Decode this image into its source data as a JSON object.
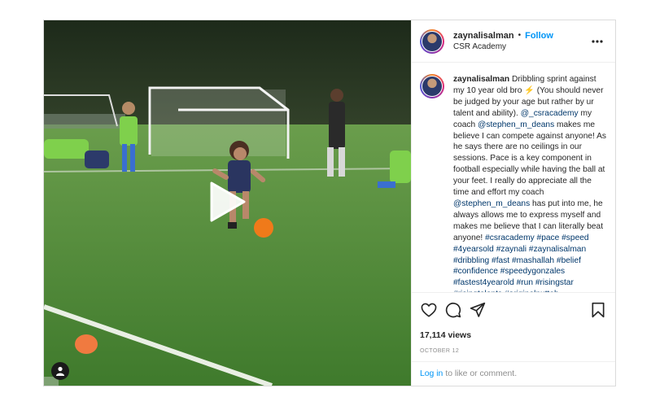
{
  "post": {
    "username": "zaynalisalman",
    "separator": "•",
    "follow_label": "Follow",
    "location": "CSR Academy"
  },
  "caption": {
    "username": "zaynalisalman",
    "t1": "Dribbling sprint against my 10 year old bro ",
    "emoji": "⚡️",
    "t2": " (You should never be judged by your age but rather by ur talent and ability). ",
    "mention1": "@_csracademy",
    "t3": " my coach ",
    "mention2": "@stephen_m_deans",
    "t4": " makes me believe I can compete against anyone! As he says there are no ceilings in our sessions. Pace is a key component in football especially while having the ball at your feet. I really do appreciate all the time and effort my coach ",
    "mention3": "@stephen_m_deans",
    "t5": " has put into me, he always allows me to express myself and makes me believe that I can literally beat anyone! ",
    "hashtags": [
      "#csracademy",
      "#pace",
      "#speed",
      "#4yearsold",
      "#zaynali",
      "#zaynalisalman",
      "#dribbling",
      "#fast",
      "#mashallah",
      "#belief",
      "#confidence",
      "#speedygonzales",
      "#fastest4yearold",
      "#run",
      "#risingstar",
      "#risingtalents",
      "#originalnuttah"
    ]
  },
  "stats": {
    "views": "17,114 views",
    "date": "October 12"
  },
  "login": {
    "link": "Log in",
    "text": "to like or comment."
  },
  "icons": {
    "like": "heart-icon",
    "comment": "comment-icon",
    "share": "share-icon",
    "save": "bookmark-icon",
    "more": "more-options-icon",
    "play": "play-icon",
    "tag": "user-tag-icon"
  },
  "colors": {
    "accent": "#0095f6",
    "link": "#00376b",
    "muted": "#8e8e8e"
  }
}
